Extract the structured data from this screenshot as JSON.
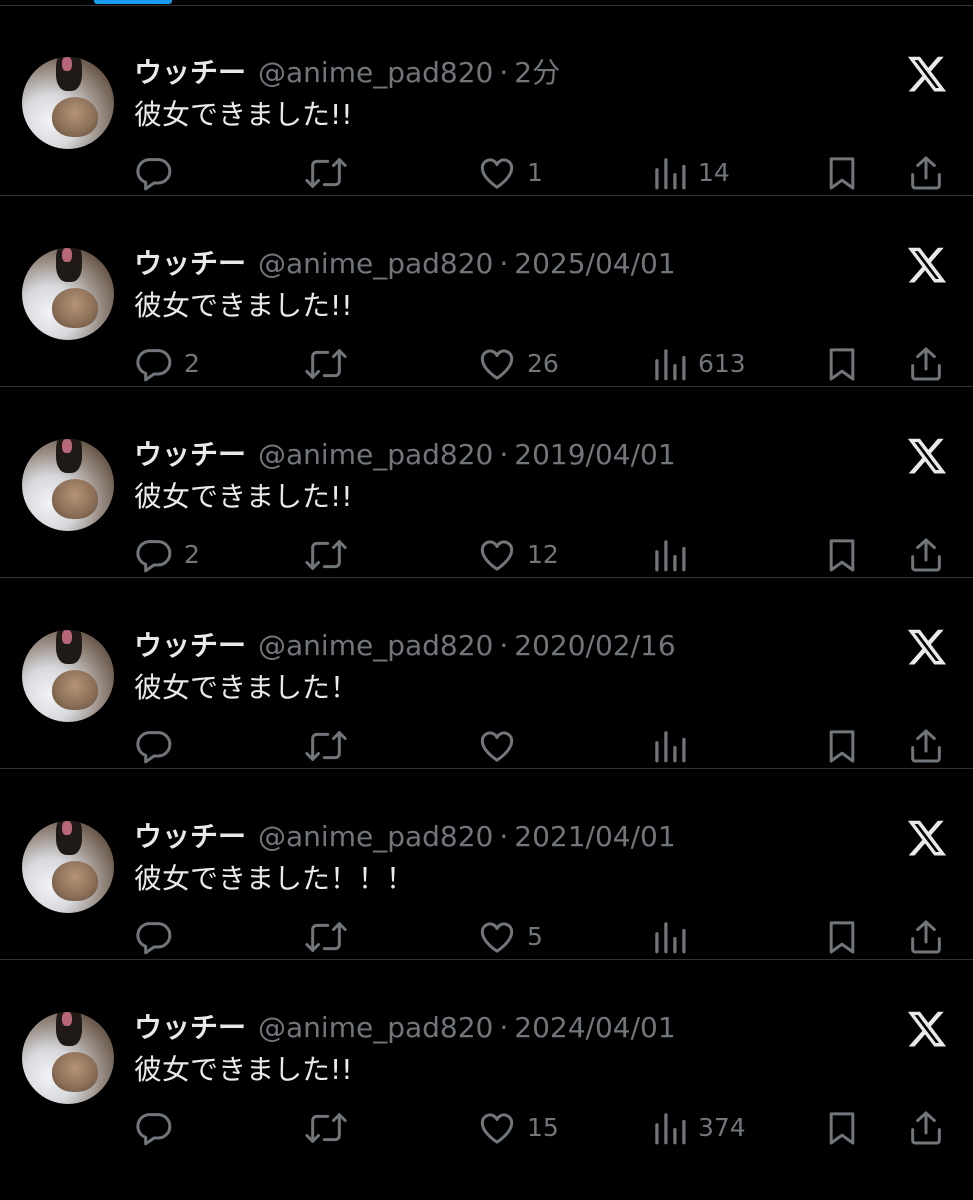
{
  "colors": {
    "background": "#000000",
    "text_primary": "#e7e9ea",
    "text_secondary": "#71767b",
    "divider": "#2f3336",
    "accent": "#1d9bf0"
  },
  "icons": {
    "reply": "reply-icon",
    "retweet": "retweet-icon",
    "like": "heart-icon",
    "views": "views-icon",
    "bookmark": "bookmark-icon",
    "share": "share-icon",
    "brand": "x-logo-icon"
  },
  "tweets": [
    {
      "name": "ウッチー",
      "handle": "@anime_pad820",
      "separator": "·",
      "time": "2分",
      "text": "彼女できました!!",
      "replies": "",
      "likes": "1",
      "views": "14"
    },
    {
      "name": "ウッチー",
      "handle": "@anime_pad820",
      "separator": "·",
      "time": "2025/04/01",
      "text": "彼女できました!!",
      "replies": "2",
      "likes": "26",
      "views": "613"
    },
    {
      "name": "ウッチー",
      "handle": "@anime_pad820",
      "separator": "·",
      "time": "2019/04/01",
      "text": "彼女できました!!",
      "replies": "2",
      "likes": "12",
      "views": ""
    },
    {
      "name": "ウッチー",
      "handle": "@anime_pad820",
      "separator": "·",
      "time": "2020/02/16",
      "text": "彼女できました！",
      "replies": "",
      "likes": "",
      "views": ""
    },
    {
      "name": "ウッチー",
      "handle": "@anime_pad820",
      "separator": "·",
      "time": "2021/04/01",
      "text": "彼女できました！！！",
      "replies": "",
      "likes": "5",
      "views": ""
    },
    {
      "name": "ウッチー",
      "handle": "@anime_pad820",
      "separator": "·",
      "time": "2024/04/01",
      "text": "彼女できました!!",
      "replies": "",
      "likes": "15",
      "views": "374"
    }
  ]
}
